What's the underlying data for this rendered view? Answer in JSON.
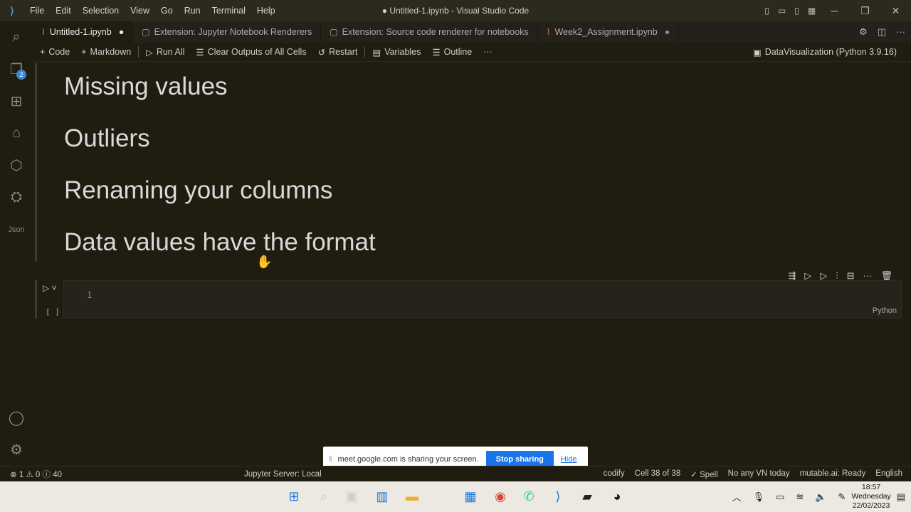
{
  "titlebar": {
    "menus": [
      "File",
      "Edit",
      "Selection",
      "View",
      "Go",
      "Run",
      "Terminal",
      "Help"
    ],
    "title": "● Untitled-1.ipynb - Visual Studio Code"
  },
  "activity": {
    "explorer_badge": "2"
  },
  "tabs": [
    {
      "label": "Untitled-1.ipynb",
      "dirty": "●"
    },
    {
      "label": "Extension: Jupyter Notebook Renderers"
    },
    {
      "label": "Extension: Source code renderer for notebooks"
    },
    {
      "label": "Week2_Assignment.ipynb",
      "dirty": "●"
    }
  ],
  "toolbar": {
    "code": "Code",
    "markdown": "Markdown",
    "run_all": "Run All",
    "clear_outputs": "Clear Outputs of All Cells",
    "restart": "Restart",
    "variables": "Variables",
    "outline": "Outline",
    "more": "···",
    "kernel": "DataVisualization (Python 3.9.16)"
  },
  "markdown_cell": {
    "lines": [
      "Missing values",
      "Outliers",
      "Renaming your columns",
      "Data values have the format"
    ]
  },
  "code_cell": {
    "line_number": "1",
    "exec_count": "[ ]",
    "language": "Python"
  },
  "share_bar": {
    "message": "meet.google.com is sharing your screen.",
    "stop": "Stop sharing",
    "hide": "Hide"
  },
  "status": {
    "problems": "⊗ 1 ⚠ 0 ⓘ 40",
    "jupyter": "Jupyter Server: Local",
    "codify": "codify",
    "cell": "Cell 38 of 38",
    "spell": "✓ Spell",
    "vn": "No any VN today",
    "mutable": "mutable.ai: Ready",
    "language": "English"
  },
  "clock": {
    "time": "18:57",
    "day": "Wednesday",
    "date": "22/02/2023"
  }
}
